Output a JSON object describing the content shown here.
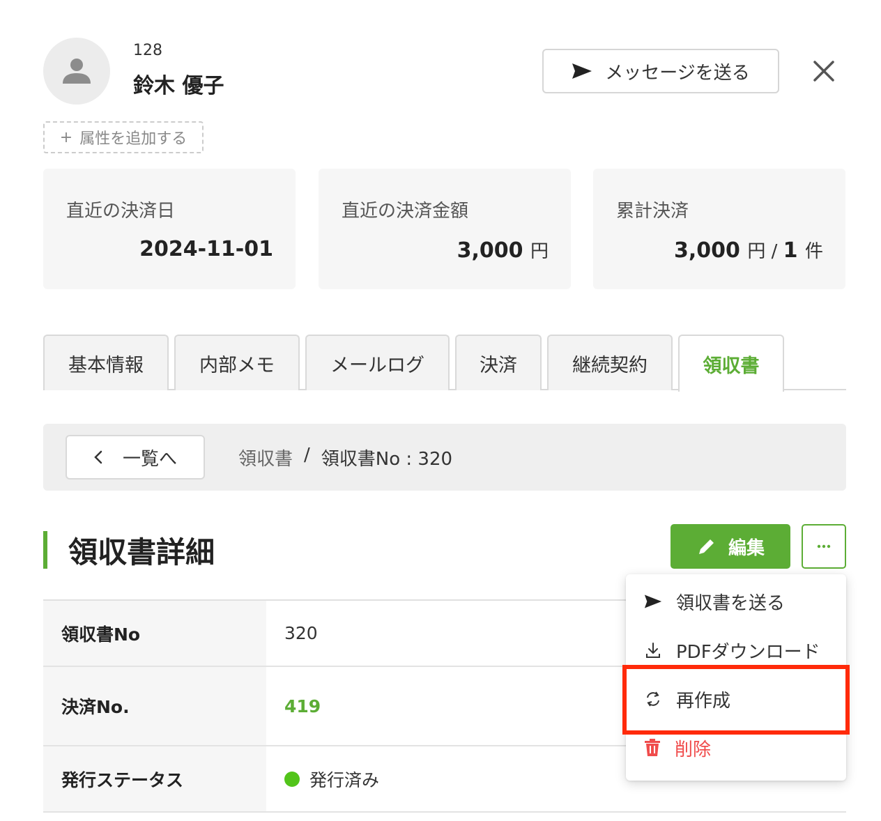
{
  "user": {
    "id": "128",
    "name": "鈴木 優子"
  },
  "header": {
    "message_button": "メッセージを送る",
    "add_attribute": "属性を追加する"
  },
  "stats": [
    {
      "label": "直近の決済日",
      "value": "2024-11-01",
      "unit": ""
    },
    {
      "label": "直近の決済金額",
      "value": "3,000",
      "unit": "円"
    },
    {
      "label": "累計決済",
      "value": "3,000",
      "unit": "円",
      "sep": " / ",
      "count": "1",
      "count_unit": "件"
    }
  ],
  "tabs": [
    {
      "label": "基本情報"
    },
    {
      "label": "内部メモ"
    },
    {
      "label": "メールログ"
    },
    {
      "label": "決済"
    },
    {
      "label": "継続契約"
    },
    {
      "label": "領収書",
      "active": true
    }
  ],
  "breadcrumb": {
    "back_label": "一覧へ",
    "parent": "領収書",
    "separator": "/",
    "current": "領収書No : 320"
  },
  "section": {
    "title": "領収書詳細",
    "edit_label": "編集"
  },
  "details": [
    {
      "label": "領収書No",
      "value": "320"
    },
    {
      "label": "決済No.",
      "value": "419"
    },
    {
      "label": "発行ステータス",
      "value": "発行済み"
    }
  ],
  "menu": {
    "items": [
      {
        "label": "領収書を送る",
        "icon": "send-icon"
      },
      {
        "label": "PDFダウンロード",
        "icon": "download-icon"
      },
      {
        "label": "再作成",
        "icon": "refresh-icon"
      },
      {
        "label": "削除",
        "icon": "trash-icon"
      }
    ]
  },
  "colors": {
    "accent": "#5cad35",
    "danger": "#f04c4c",
    "highlight": "#ff2a0a",
    "status_ok": "#52c41a"
  }
}
